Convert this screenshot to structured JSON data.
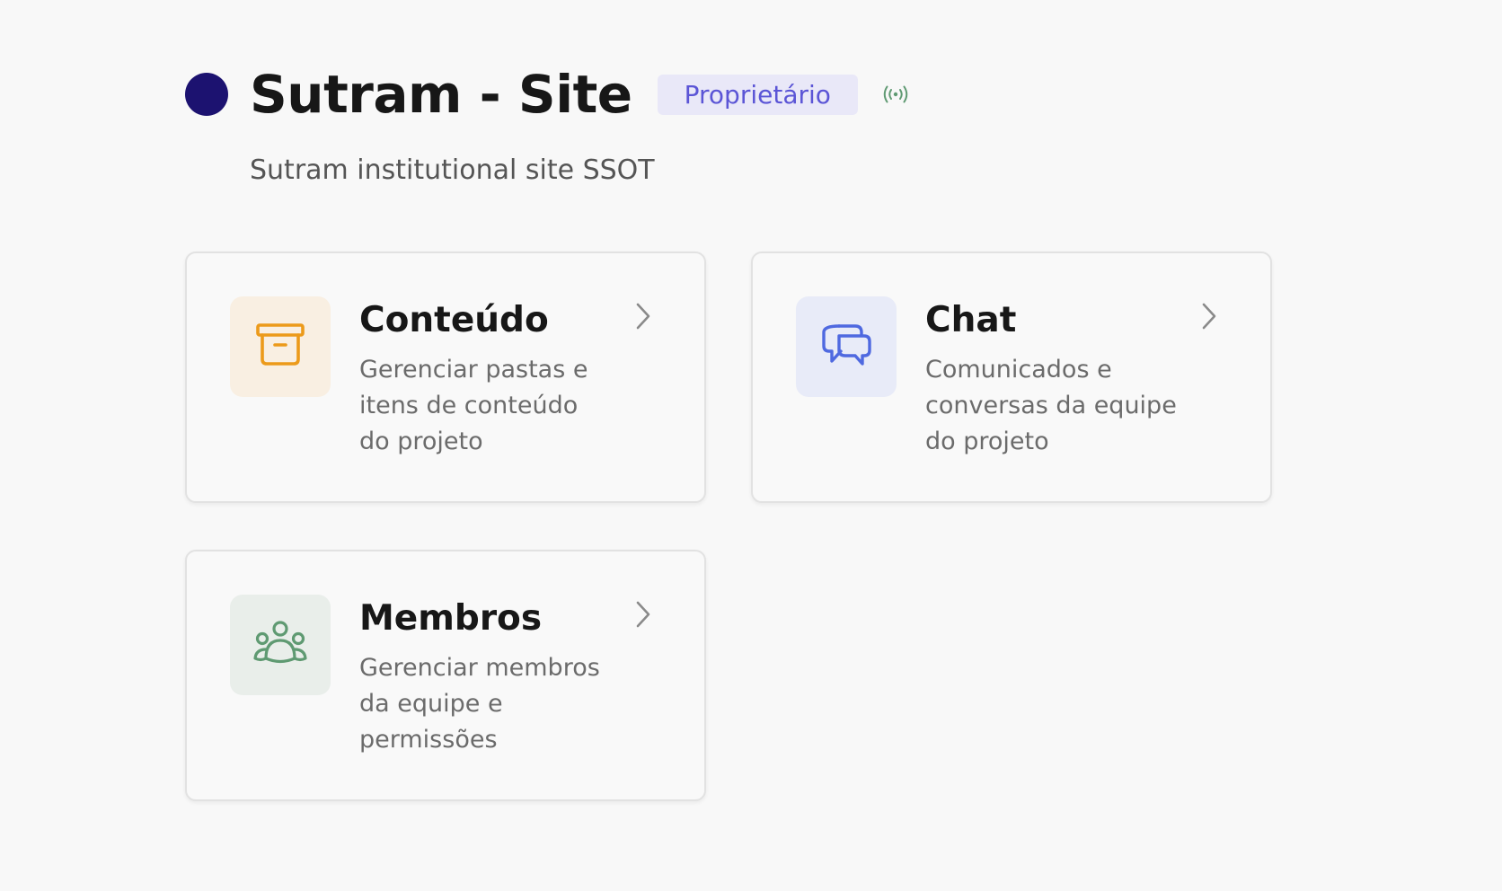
{
  "project": {
    "title": "Sutram - Site",
    "role": "Proprietário",
    "description": "Sutram institutional site SSOT",
    "dot_color": "#1c1270"
  },
  "colors": {
    "badge_bg": "#e9e8f8",
    "badge_text": "#5b55d6",
    "live": "#5f9a72"
  },
  "cards": [
    {
      "title": "Conteúdo",
      "description": "Gerenciar pastas e itens de conteúdo do projeto",
      "icon": "archive-box-icon",
      "icon_color": "#ec9a1a",
      "icon_bg": "#f9efe2"
    },
    {
      "title": "Chat",
      "description": "Comunicados e conversas da equipe do projeto",
      "icon": "chat-bubbles-icon",
      "icon_color": "#4f69e0",
      "icon_bg": "#e8ebf8"
    },
    {
      "title": "Membros",
      "description": "Gerenciar membros da equipe e permissões",
      "icon": "team-members-icon",
      "icon_color": "#5f9a72",
      "icon_bg": "#e9eeea"
    }
  ]
}
